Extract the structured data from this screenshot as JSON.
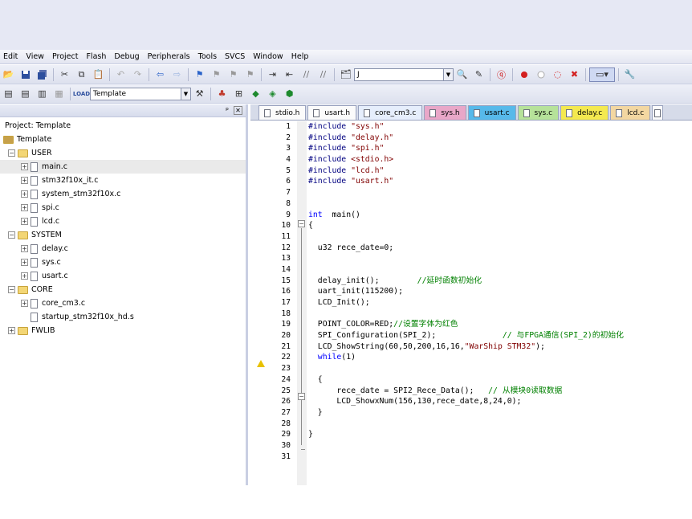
{
  "menu": [
    "Edit",
    "View",
    "Project",
    "Flash",
    "Debug",
    "Peripherals",
    "Tools",
    "SVCS",
    "Window",
    "Help"
  ],
  "toolbar": {
    "find_value": "J",
    "target": "Template"
  },
  "project": {
    "root_label": "Project: Template",
    "target": "Template",
    "groups": [
      {
        "name": "USER",
        "files": [
          "main.c",
          "stm32f10x_it.c",
          "system_stm32f10x.c",
          "spi.c",
          "lcd.c"
        ]
      },
      {
        "name": "SYSTEM",
        "files": [
          "delay.c",
          "sys.c",
          "usart.c"
        ]
      },
      {
        "name": "CORE",
        "files": [
          "core_cm3.c",
          "startup_stm32f10x_hd.s"
        ]
      },
      {
        "name": "FWLIB",
        "files": []
      }
    ]
  },
  "tabs": [
    {
      "label": "stdio.h"
    },
    {
      "label": "usart.h"
    },
    {
      "label": "core_cm3.c"
    },
    {
      "label": "sys.h"
    },
    {
      "label": "usart.c"
    },
    {
      "label": "sys.c"
    },
    {
      "label": "delay.c"
    },
    {
      "label": "lcd.c"
    }
  ],
  "colors": {
    "preprocessor": "#000080",
    "string": "#800000",
    "keyword": "#0000ff",
    "comment": "#008000"
  },
  "code_lines": [
    [
      [
        "pp",
        "#include "
      ],
      [
        "str",
        "\"sys.h\""
      ]
    ],
    [
      [
        "pp",
        "#include "
      ],
      [
        "str",
        "\"delay.h\""
      ]
    ],
    [
      [
        "pp",
        "#include "
      ],
      [
        "str",
        "\"spi.h\""
      ]
    ],
    [
      [
        "pp",
        "#include "
      ],
      [
        "str",
        "<stdio.h>"
      ]
    ],
    [
      [
        "pp",
        "#include "
      ],
      [
        "str",
        "\"lcd.h\""
      ]
    ],
    [
      [
        "pp",
        "#include "
      ],
      [
        "str",
        "\"usart.h\""
      ]
    ],
    [],
    [],
    [
      [
        "kw",
        "int"
      ],
      [
        "",
        "  main()"
      ]
    ],
    [
      [
        "",
        "{"
      ]
    ],
    [],
    [
      [
        "",
        "  u32 rece_date=0;"
      ]
    ],
    [],
    [],
    [
      [
        "",
        "  delay_init();        "
      ],
      [
        "cm",
        "//延时函数初始化"
      ]
    ],
    [
      [
        "",
        "  uart_init(115200);"
      ]
    ],
    [
      [
        "",
        "  LCD_Init();"
      ]
    ],
    [],
    [
      [
        "",
        "  POINT_COLOR=RED;"
      ],
      [
        "cm",
        "//设置字体为红色"
      ]
    ],
    [
      [
        "",
        "  SPI_Configuration(SPI_2);              "
      ],
      [
        "cm",
        "// 与FPGA通信(SPI_2)的初始化"
      ]
    ],
    [
      [
        "",
        "  LCD_ShowString(60,50,200,16,16,"
      ],
      [
        "str",
        "\"WarShip STM32\""
      ],
      [
        "",
        ");"
      ]
    ],
    [
      [
        "kw",
        "  while"
      ],
      [
        "",
        "(1)"
      ]
    ],
    [],
    [
      [
        "",
        "  {"
      ]
    ],
    [
      [
        "",
        "      rece_date = SPI2_Rece_Data();   "
      ],
      [
        "cm",
        "// 从模块0读取数据"
      ]
    ],
    [
      [
        "",
        "      LCD_ShowxNum(156,130,rece_date,8,24,0);"
      ]
    ],
    [
      [
        "",
        "  }"
      ]
    ],
    [],
    [
      [
        "",
        "}"
      ]
    ],
    [],
    []
  ],
  "line_numbers": [
    "1",
    "2",
    "3",
    "4",
    "5",
    "6",
    "7",
    "8",
    "9",
    "10",
    "11",
    "12",
    "13",
    "14",
    "15",
    "16",
    "17",
    "18",
    "19",
    "20",
    "21",
    "22",
    "23",
    "24",
    "25",
    "26",
    "27",
    "28",
    "29",
    "30",
    "31"
  ]
}
